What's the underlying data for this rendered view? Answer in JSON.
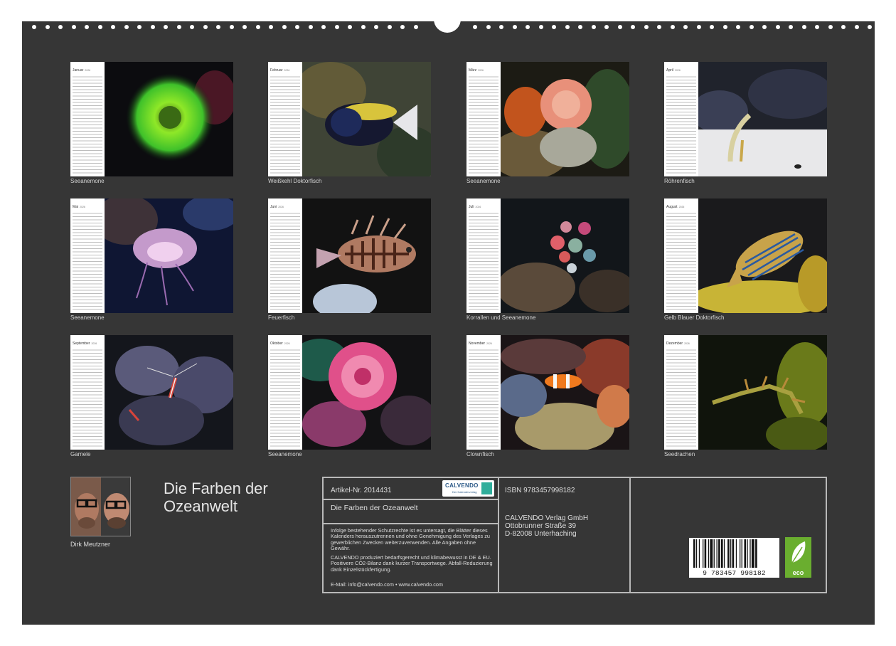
{
  "months": [
    {
      "title": "Januar",
      "year": "2026",
      "caption": "Seeanemone"
    },
    {
      "title": "Februar",
      "year": "2026",
      "caption": "Weißkehl Doktorfisch"
    },
    {
      "title": "März",
      "year": "2026",
      "caption": "Seeanemone"
    },
    {
      "title": "April",
      "year": "2026",
      "caption": "Röhrenfisch"
    },
    {
      "title": "Mai",
      "year": "2026",
      "caption": "Seeanemone"
    },
    {
      "title": "Juni",
      "year": "2026",
      "caption": "Feuerfisch"
    },
    {
      "title": "Juli",
      "year": "2026",
      "caption": "Korrallen und Seeanemone"
    },
    {
      "title": "August",
      "year": "2026",
      "caption": "Gelb Blauer Doktorfisch"
    },
    {
      "title": "September",
      "year": "2026",
      "caption": "Garnele"
    },
    {
      "title": "Oktober",
      "year": "2026",
      "caption": "Seeanemone"
    },
    {
      "title": "November",
      "year": "2026",
      "caption": "Clownfisch"
    },
    {
      "title": "Dezember",
      "year": "2026",
      "caption": "Seedrachen"
    }
  ],
  "author": {
    "name": "Dirk Meutzner"
  },
  "title": {
    "line1": "Die Farben der",
    "line2": "Ozeanwelt"
  },
  "info": {
    "article": "Artikel-Nr. 2014431",
    "calendar_title": "Die Farben der Ozeanwelt",
    "logo_text": "CALVENDO",
    "logo_tagline": "Der Kalenderverlag",
    "copyright": "Infolge bestehender Schutzrechte ist es untersagt, die Blätter dieses Kalenders herauszutrennen und ohne Genehmigung des Verlages zu gewerblichen Zwecken weiterzuverwenden. Alle Angaben ohne Gewähr.",
    "eco_note": "CALVENDO produziert bedarfsgerecht und klimabewusst in DE & EU. Positivere CO2-Bilanz dank kurzer Transportwege. Abfall-Reduzierung dank Einzelstückfertigung.",
    "contact": "E-Mail: info@calvendo.com • www.calvendo.com",
    "isbn": "ISBN 9783457998182",
    "publisher": "CALVENDO Verlag GmbH",
    "street": "Ottobrunner Straße 39",
    "city": "D-82008 Unterhaching",
    "barcode_digits": "9 783457 998182",
    "eco_label": "eco"
  },
  "colors": {
    "sheet": "#363636",
    "panel_border": "#b9b9b9",
    "eco_green": "#6aae2f",
    "calvendo_blue": "#2c5a88"
  }
}
